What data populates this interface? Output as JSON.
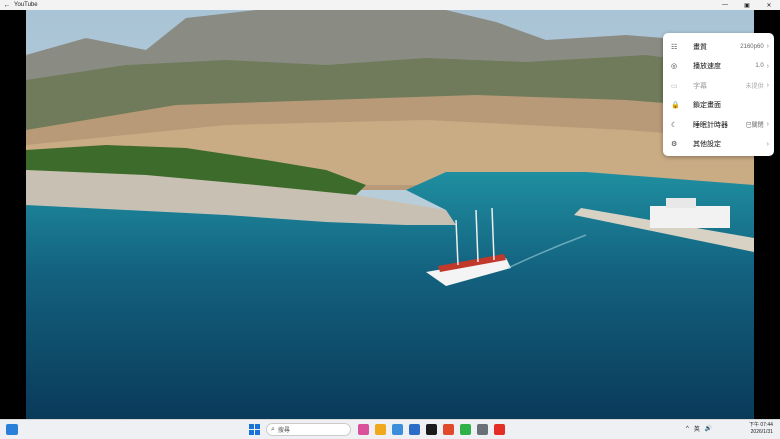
{
  "window": {
    "title": "YouTube",
    "back_icon": "←",
    "minimize": "—",
    "maximize": "▣",
    "close": "✕"
  },
  "settings": {
    "items": [
      {
        "icon": "sliders-icon",
        "glyph": "☷",
        "label": "畫質",
        "value": "2160p60",
        "chevron": "›",
        "disabled": false
      },
      {
        "icon": "playback-speed-icon",
        "glyph": "◎",
        "label": "播放速度",
        "value": "1.0",
        "chevron": "›",
        "disabled": false
      },
      {
        "icon": "captions-icon",
        "glyph": "▭",
        "label": "字幕",
        "value": "未提供",
        "chevron": "›",
        "disabled": true
      },
      {
        "icon": "lock-icon",
        "glyph": "🔒",
        "label": "鎖定畫面",
        "value": "",
        "chevron": "",
        "disabled": false
      },
      {
        "icon": "sleep-timer-icon",
        "glyph": "☾",
        "label": "睡眠計時器",
        "value": "已關閉",
        "chevron": "›",
        "disabled": false
      },
      {
        "icon": "gear-icon",
        "glyph": "⚙",
        "label": "其他設定",
        "value": "",
        "chevron": "›",
        "disabled": false
      }
    ]
  },
  "taskbar": {
    "search_placeholder": "搜尋",
    "app_colors": [
      "#d94f9a",
      "#f0a81c",
      "#3b8ed9",
      "#2c6cc6",
      "#1b1b1b",
      "#e04a2b",
      "#2fb14a",
      "#6b7078",
      "#e52d27"
    ],
    "tray": {
      "chevron": "^",
      "ime": "英",
      "volume": "🔊"
    },
    "clock": {
      "time": "下午 07:44",
      "date": "2026/1/31"
    }
  }
}
